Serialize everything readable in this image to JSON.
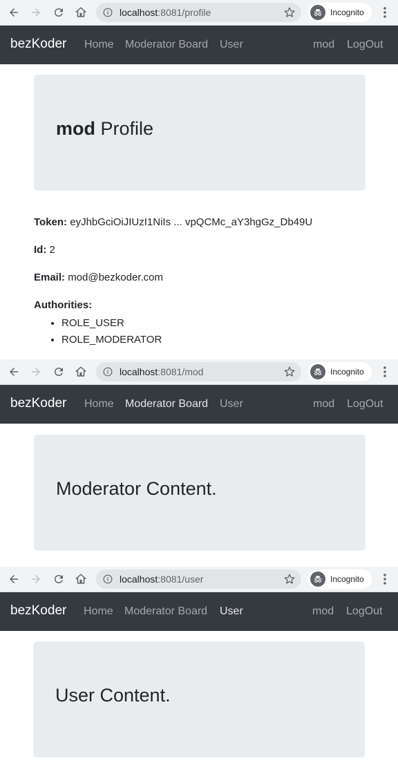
{
  "browser": {
    "incognito_label": "Incognito",
    "windows": [
      {
        "url_host": "localhost",
        "url_path": ":8081/profile"
      },
      {
        "url_host": "localhost",
        "url_path": ":8081/mod"
      },
      {
        "url_host": "localhost",
        "url_path": ":8081/user"
      }
    ]
  },
  "navbar": {
    "brand": "bezKoder",
    "links": [
      "Home",
      "Moderator Board",
      "User"
    ],
    "user": "mod",
    "logout": "LogOut",
    "active_by_window": [
      "",
      "Moderator Board",
      "User"
    ]
  },
  "profile": {
    "username": "mod",
    "title_suffix": "Profile",
    "token_label": "Token:",
    "token_value": "eyJhbGciOiJIUzI1NiIs ... vpQCMc_aY3hgGz_Db49U",
    "id_label": "Id:",
    "id_value": "2",
    "email_label": "Email:",
    "email_value": "mod@bezkoder.com",
    "authorities_label": "Authorities:",
    "authorities": [
      "ROLE_USER",
      "ROLE_MODERATOR"
    ]
  },
  "moderator_page": {
    "content": "Moderator Content."
  },
  "user_page": {
    "content": "User Content."
  },
  "colors": {
    "navbar_bg": "#343a40",
    "jumbotron_bg": "#e9ecef",
    "chrome_bg": "#f1f3f4"
  }
}
